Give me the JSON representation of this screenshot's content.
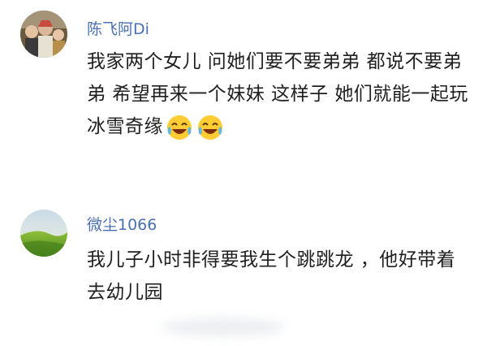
{
  "comments": [
    {
      "username": "陈飞阿Di",
      "text": "我家两个女儿 问她们要不要弟弟 都说不要弟弟 希望再来一个妹妹 这样子 她们就能一起玩冰雪奇缘",
      "emojis": [
        "laugh-cry-emoji",
        "laugh-cry-emoji"
      ],
      "avatar_icon": "family-photo-avatar"
    },
    {
      "username": "微尘1066",
      "text": "我儿子小时非得要我生个跳跳龙 ，他好带着去幼儿园",
      "avatar_icon": "green-hill-landscape-avatar"
    }
  ],
  "colors": {
    "username": "#4a6fb0",
    "text": "#1f1f1f",
    "background": "#ffffff"
  }
}
